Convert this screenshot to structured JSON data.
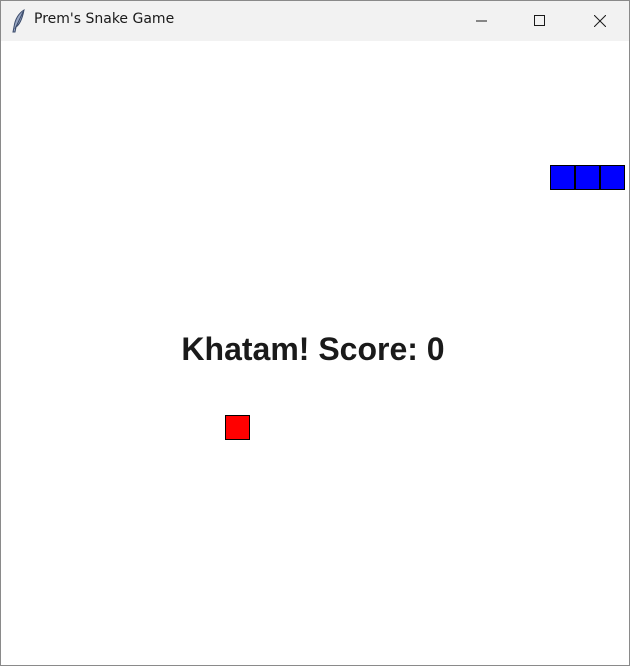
{
  "window": {
    "title": "Prem's Snake Game",
    "icon": "feather-icon",
    "controls": [
      "minimize-icon",
      "maximize-icon",
      "close-icon"
    ]
  },
  "game": {
    "message": "Khatam! Score: 0",
    "score": 0,
    "snake_color": "#0000ff",
    "food_color": "#ff0000",
    "snake_length": 3
  }
}
